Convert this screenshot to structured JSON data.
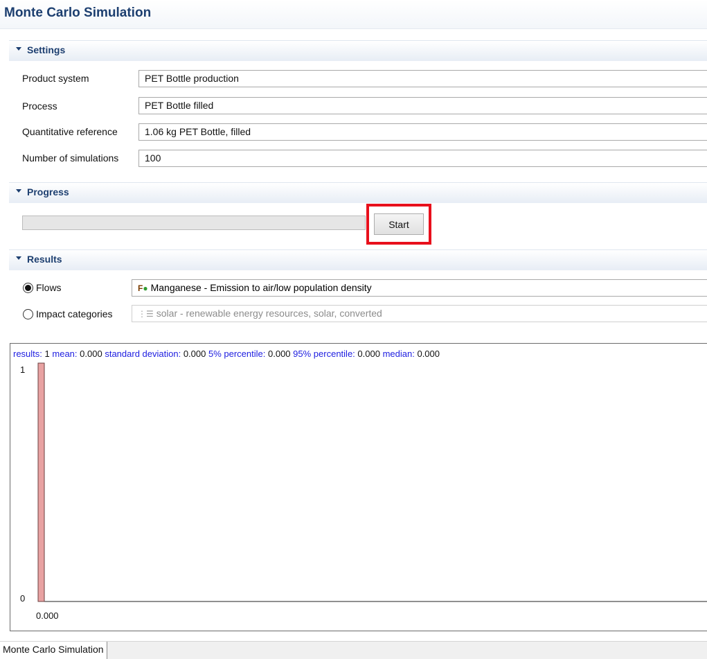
{
  "page": {
    "title": "Monte Carlo Simulation"
  },
  "settings": {
    "section_title": "Settings",
    "fields": [
      {
        "label": "Product system",
        "value": "PET Bottle production"
      },
      {
        "label": "Process",
        "value": "PET Bottle filled"
      },
      {
        "label": "Quantitative reference",
        "value": "1.06 kg PET Bottle, filled"
      },
      {
        "label": "Number of simulations",
        "value": "100"
      }
    ]
  },
  "progress": {
    "section_title": "Progress",
    "fraction": 0,
    "start_label": "Start"
  },
  "results": {
    "section_title": "Results",
    "flows_label": "Flows",
    "flows_selected": true,
    "flow_icon": "flow-icon",
    "flow_value": "Manganese - Emission to air/low population density",
    "impact_label": "Impact categories",
    "impact_selected": false,
    "impact_icon": "impact-category-icon",
    "impact_value": "solar - renewable energy resources, solar, converted"
  },
  "stats": {
    "results_label": "results:",
    "results_value": "1",
    "mean_label": "mean:",
    "mean_value": "0.000",
    "sd_label": "standard deviation:",
    "sd_value": "0.000",
    "p5_label": "5% percentile:",
    "p5_value": "0.000",
    "p95_label": "95% percentile:",
    "p95_value": "0.000",
    "median_label": "median:",
    "median_value": "0.000"
  },
  "chart_data": {
    "type": "bar",
    "categories": [
      "0.000"
    ],
    "values": [
      1
    ],
    "ylim": [
      0,
      1
    ],
    "yticks": [
      "1",
      "0"
    ],
    "bar_color": "#e8a2a2"
  },
  "status": {
    "tab_label": "Monte Carlo Simulation"
  }
}
